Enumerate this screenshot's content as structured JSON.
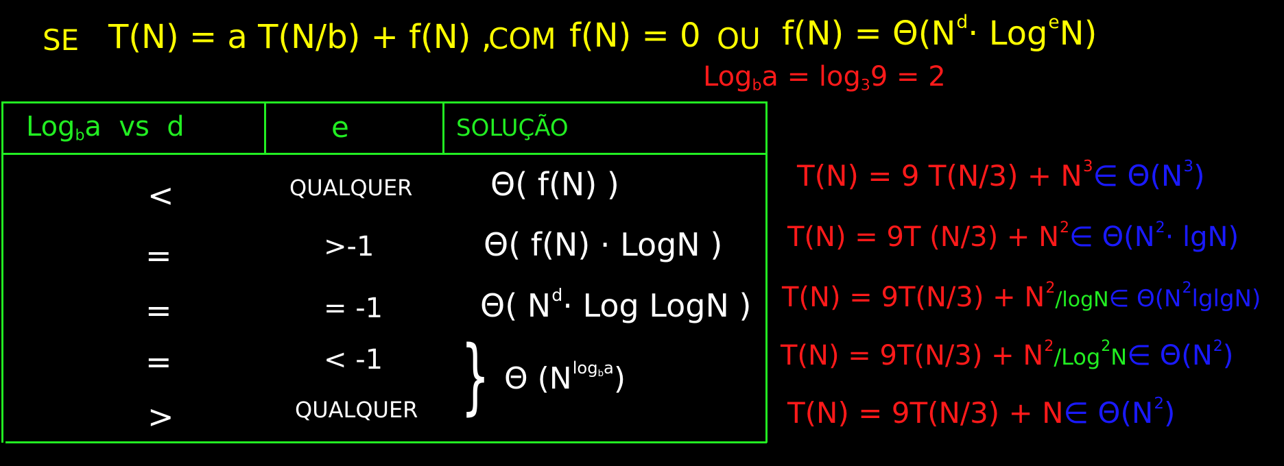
{
  "header": {
    "se": "SE",
    "recurrence": "T(N) = a T(N/b) + f(N) ,",
    "com": "COM",
    "f_zero": "f(N) = 0",
    "ou": "OU",
    "f_theta_prefix": "f(N) = Θ(N",
    "d": "d",
    "dot_log": "· Log",
    "e": "e",
    "n_close": "N)"
  },
  "log_calc": {
    "log": "Log",
    "b": "b",
    "a_eq": "a = log",
    "three": "3",
    "rest": "9 = 2"
  },
  "table": {
    "headers": {
      "col1_log": "Log",
      "col1_b": "b",
      "col1_rest": "a  vs  d",
      "col2": "e",
      "col3": "SOLUÇÃO"
    },
    "rows": [
      {
        "cmp": "<",
        "e": "QUALQUER",
        "sol_a": "Θ( f(N) )",
        "sol_sup": "",
        "sol_b": ""
      },
      {
        "cmp": "=",
        "e": ">-1",
        "sol_a": "Θ( f(N) · LogN )",
        "sol_sup": "",
        "sol_b": ""
      },
      {
        "cmp": "=",
        "e": "= -1",
        "sol_a": "Θ( N",
        "sol_sup": "d",
        "sol_b": "· Log LogN )"
      },
      {
        "cmp": "=",
        "e": "< -1",
        "sol_a": "",
        "sol_sup": "",
        "sol_b": ""
      },
      {
        "cmp": ">",
        "e": "QUALQUER",
        "sol_a": "",
        "sol_sup": "",
        "sol_b": ""
      }
    ],
    "brace_solution": {
      "brace": "}",
      "prefix": "Θ (N",
      "sup": "log",
      "sup_b": "b",
      "sup_a": "a",
      "close": ")"
    }
  },
  "examples": [
    {
      "red": "T(N) = 9 T(N/3) + N",
      "red_sup": "3",
      "green": "",
      "green_sup": "",
      "green_tail": "",
      "blue": "∈ Θ(N",
      "blue_sup": "3",
      "blue_tail": ")"
    },
    {
      "red": "T(N) = 9T (N/3) + N",
      "red_sup": "2",
      "green": "",
      "green_sup": "",
      "green_tail": "",
      "blue": "∈ Θ(N",
      "blue_sup": "2",
      "blue_tail": "· lgN)"
    },
    {
      "red": "T(N) = 9T(N/3) + N",
      "red_sup": "2",
      "green": "/logN",
      "green_sup": "",
      "green_tail": "",
      "blue": "∈ Θ(N",
      "blue_sup": "2",
      "blue_tail": "lglgN)"
    },
    {
      "red": "T(N) = 9T(N/3) + N",
      "red_sup": "2",
      "green": "/Log",
      "green_sup": "2",
      "green_tail": "N",
      "blue": "∈ Θ(N",
      "blue_sup": "2",
      "blue_tail": ")"
    },
    {
      "red": "T(N) = 9T(N/3) + N",
      "red_sup": "",
      "green": "",
      "green_sup": "",
      "green_tail": "",
      "blue": "∈ Θ(N",
      "blue_sup": "2",
      "blue_tail": ")"
    }
  ]
}
